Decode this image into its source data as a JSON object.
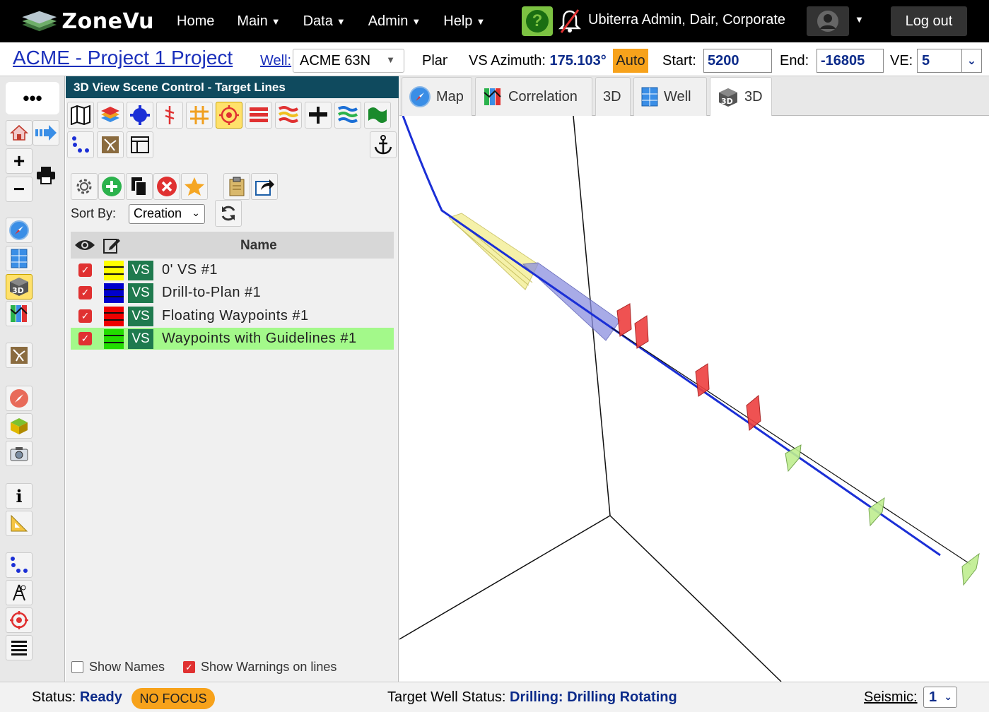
{
  "nav": {
    "logo_text": "ZoneVu",
    "items": [
      {
        "label": "Home",
        "caret": false
      },
      {
        "label": "Main",
        "caret": true
      },
      {
        "label": "Data",
        "caret": true
      },
      {
        "label": "Admin",
        "caret": true
      },
      {
        "label": "Help",
        "caret": true
      }
    ],
    "help_symbol": "?",
    "user": "Ubiterra Admin, Dair, Corporate",
    "logout": "Log out"
  },
  "project": {
    "title": "ACME - Project 1 Project",
    "well_label": "Well:",
    "well_value": "ACME 63N",
    "plan_label": "Plan",
    "vs_label": "VS Azimuth:",
    "vs_value": "175.103°",
    "auto_label": "Auto",
    "start_label": "Start:",
    "start_value": "5200",
    "end_label": "End:",
    "end_value": "-16805",
    "ve_label": "VE:",
    "ve_value": "5"
  },
  "left_toolbar": {
    "more": "•••",
    "info_symbol": "i"
  },
  "panel": {
    "title": "3D View Scene Control - Target Lines",
    "sort_label": "Sort By:",
    "sort_value": "Creation",
    "table_header": "Name",
    "rows": [
      {
        "name": "0' VS #1",
        "badge": "VS",
        "color": "#ffff00",
        "highlight": false
      },
      {
        "name": "Drill-to-Plan #1",
        "badge": "VS",
        "color": "#0000cc",
        "highlight": false
      },
      {
        "name": "Floating Waypoints #1",
        "badge": "VS",
        "color": "#ee0000",
        "highlight": false
      },
      {
        "name": "Waypoints with Guidelines #1",
        "badge": "VS",
        "color": "#22dd00",
        "highlight": true
      }
    ],
    "show_names": "Show Names",
    "show_warnings": "Show Warnings on lines"
  },
  "tabs": [
    {
      "label": "Map",
      "icon": "compass-icon",
      "active": false
    },
    {
      "label": "Correlation",
      "icon": "correlation-icon",
      "active": false
    },
    {
      "label": "3D",
      "icon": "",
      "active": false
    },
    {
      "label": "Well",
      "icon": "well-grid-icon",
      "active": false
    },
    {
      "label": "3D",
      "icon": "3d-cube-icon",
      "active": true
    }
  ],
  "status": {
    "status_label": "Status:",
    "status_value": "Ready",
    "focus": "NO FOCUS",
    "target_label": "Target Well Status:",
    "target_value": "Drilling: Drilling Rotating",
    "seismic_label": "Seismic:",
    "seismic_value": "1"
  }
}
